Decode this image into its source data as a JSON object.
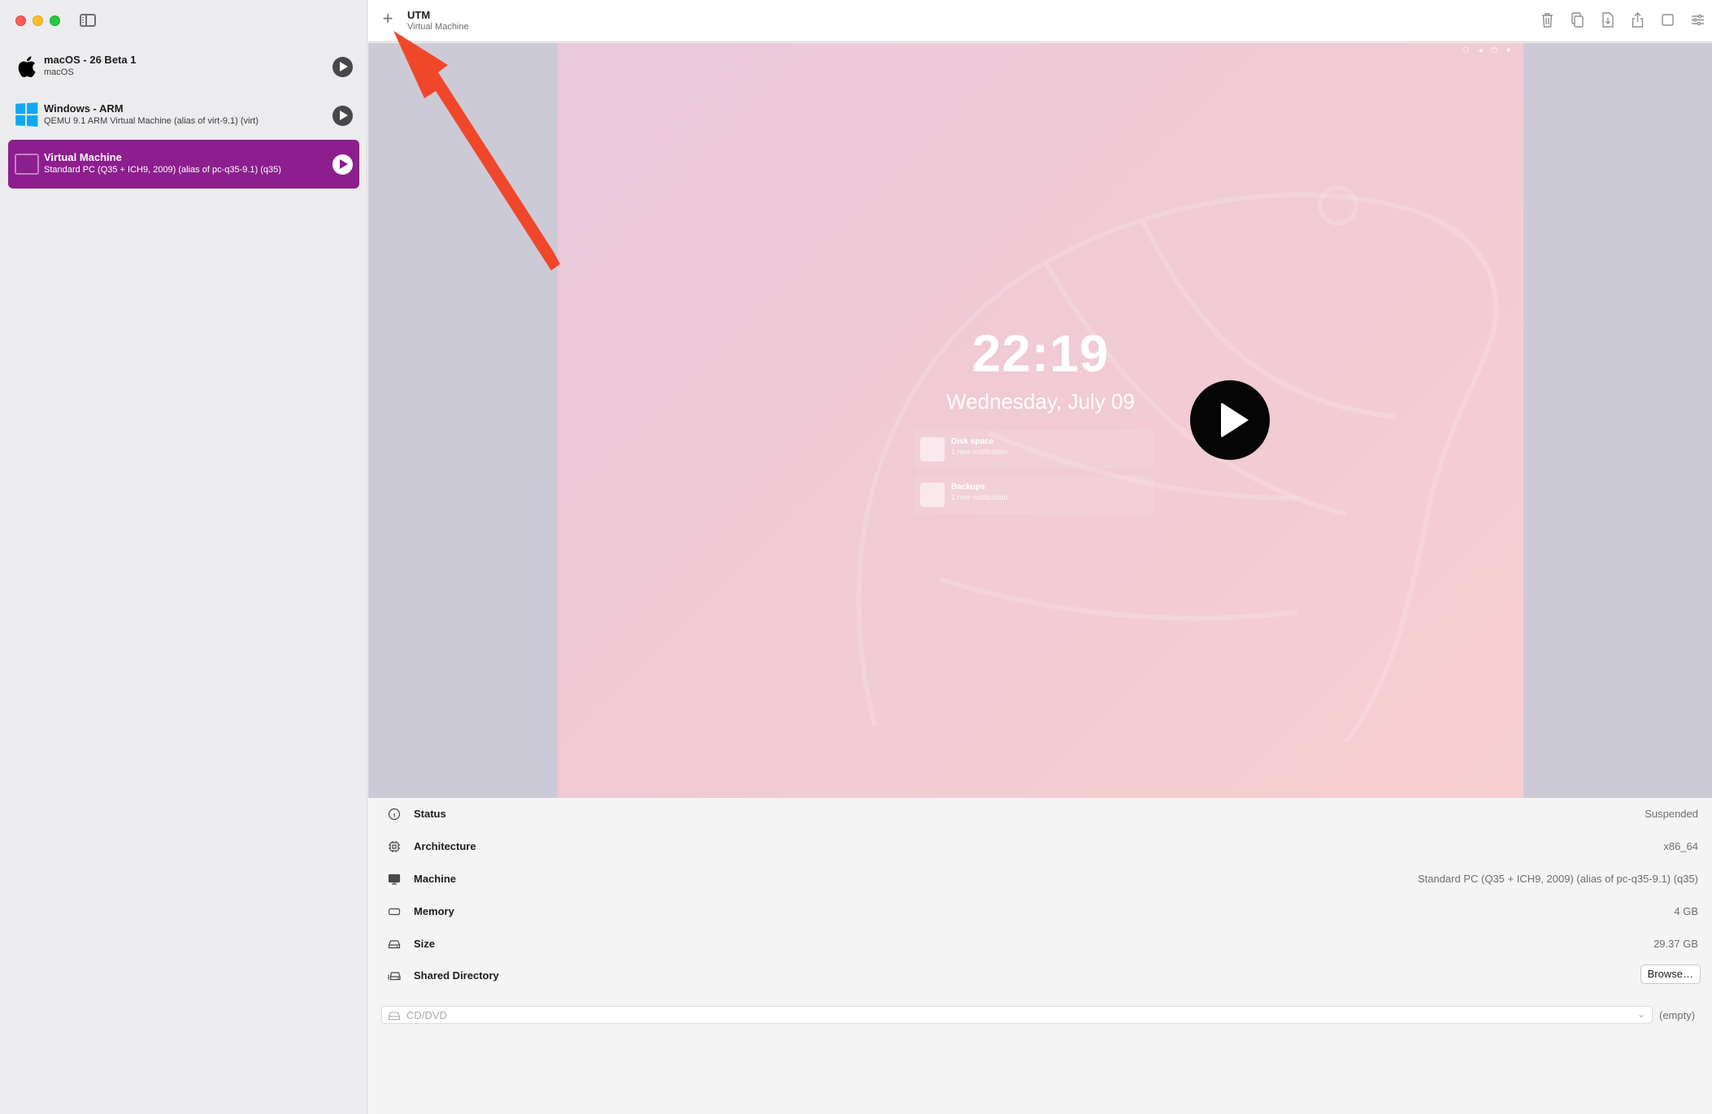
{
  "sidebar": {
    "items": [
      {
        "name": "macOS - 26 Beta 1",
        "desc": "macOS",
        "icon": "apple-logo"
      },
      {
        "name": "Windows - ARM",
        "desc": "QEMU 9.1 ARM Virtual Machine (alias of virt-9.1) (virt)",
        "icon": "windows-logo"
      },
      {
        "name": "Virtual Machine",
        "desc": "Standard PC (Q35 + ICH9, 2009) (alias of pc-q35-9.1) (q35)",
        "icon": "monitor-icon",
        "selected": true
      }
    ],
    "selected_color": "#8d1e8e"
  },
  "toolbar": {
    "add_symbol": "+",
    "title": "UTM",
    "subtitle": "Virtual Machine",
    "icons": [
      "trash-icon",
      "clone-icon",
      "download-icon",
      "share-icon",
      "window-icon",
      "settings-icon"
    ]
  },
  "screen": {
    "clock": "22:19",
    "date": "Wednesday, July 09",
    "notifications": [
      {
        "title": "Disk space",
        "subtitle": "1 new notification"
      },
      {
        "title": "Backups",
        "subtitle": "1 new notification"
      }
    ]
  },
  "info": {
    "rows": [
      {
        "label": "Status",
        "value": "Suspended",
        "icon": "info-circle-icon"
      },
      {
        "label": "Architecture",
        "value": "x86_64",
        "icon": "chip-icon"
      },
      {
        "label": "Machine",
        "value": "Standard PC (Q35 + ICH9, 2009) (alias of pc-q35-9.1) (q35)",
        "icon": "display-icon"
      },
      {
        "label": "Memory",
        "value": "4 GB",
        "icon": "memory-icon"
      },
      {
        "label": "Size",
        "value": "29.37 GB",
        "icon": "drive-icon"
      },
      {
        "label": "Shared Directory",
        "value": "",
        "icon": "shared-drive-icon"
      }
    ],
    "browse_label": "Browse…",
    "cd_placeholder": "CD/DVD",
    "cd_value": "(empty)"
  },
  "annotation": {
    "color": "#f0472a"
  }
}
